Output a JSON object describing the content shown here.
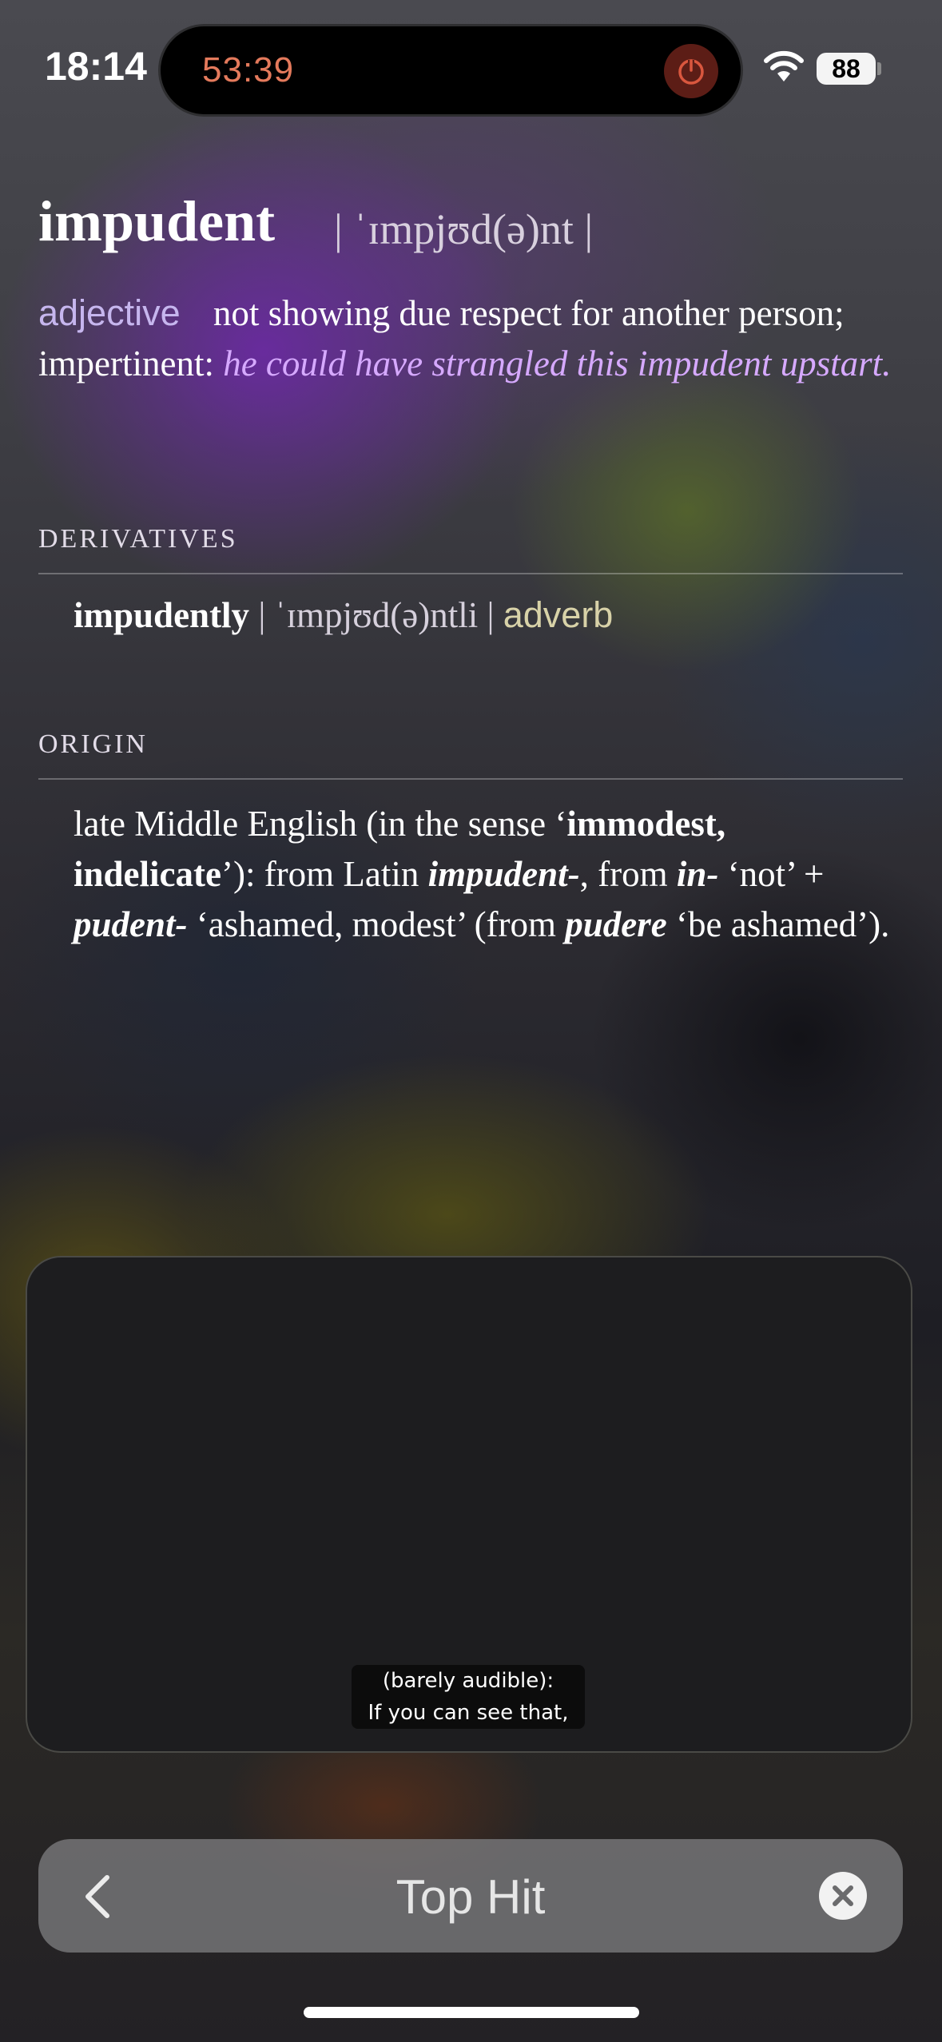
{
  "status_bar": {
    "time": "18:14",
    "island_timer": "53:39",
    "battery": "88",
    "icons": [
      "stop-icon",
      "wifi-icon",
      "battery-icon"
    ]
  },
  "entry": {
    "headword": "impudent",
    "pronunciation": "| ˈɪmpjʊd(ə)nt |",
    "part_of_speech": "adjective",
    "definition": "not showing due respect for another person; impertinent:",
    "example": "he could have strangled this impudent upstart."
  },
  "derivatives": {
    "title": "DERIVATIVES",
    "word": "impudently",
    "pronunciation": "| ˈɪmpjʊd(ə)ntli |",
    "part_of_speech": "adverb"
  },
  "origin": {
    "title": "ORIGIN",
    "t1": "late Middle English (in the sense ‘",
    "b1": "immodest, indelicate",
    "t2": "’): from Latin ",
    "bi1": "impudent-",
    "t3": ", from ",
    "bi2": "in-",
    "t4": " ‘not’ + ",
    "bi3": "pudent-",
    "t5": " ‘ashamed, modest’ (from ",
    "bi4": "pudere",
    "t6": " ‘be ashamed’)."
  },
  "video_caption": {
    "line1": "(barely audible):",
    "line2": "If you can see that,"
  },
  "search_bar": {
    "text": "Top Hit",
    "icons": [
      "chevron-left-icon",
      "clear-icon"
    ]
  },
  "colors": {
    "accent_purple": "#c6b6ee",
    "example_purple": "#d6a9ff",
    "timer_orange": "#e47a5c",
    "stop_red": "#5c1d16"
  }
}
